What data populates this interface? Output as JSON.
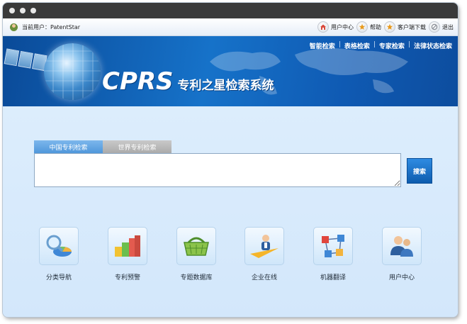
{
  "topbar": {
    "current_user_label": "当前用户：PatentStar",
    "links": [
      {
        "label": "用户中心",
        "icon": "home-icon"
      },
      {
        "label": "帮助",
        "icon": "star-icon"
      },
      {
        "label": "客户端下载",
        "icon": "star-icon"
      },
      {
        "label": "退出",
        "icon": "no-entry-icon"
      }
    ]
  },
  "banner": {
    "logo_text": "CPRS",
    "title": "专利之星检索系统",
    "search_nav": [
      "智能检索",
      "表格检索",
      "专家检索",
      "法律状态检索"
    ]
  },
  "search": {
    "tabs": [
      "中国专利检索",
      "世界专利检索"
    ],
    "active_tab": "中国专利检索",
    "query_value": "",
    "button_label": "搜索"
  },
  "features": [
    {
      "label": "分类导航",
      "icon": "magnifier-pie-icon"
    },
    {
      "label": "专利预警",
      "icon": "bar-blocks-icon"
    },
    {
      "label": "专题数据库",
      "icon": "basket-icon"
    },
    {
      "label": "企业在线",
      "icon": "paper-plane-person-icon"
    },
    {
      "label": "机器翻译",
      "icon": "network-nodes-icon"
    },
    {
      "label": "用户中心",
      "icon": "users-icon"
    }
  ],
  "colors": {
    "banner_blue": "#1672c9",
    "tab_active": "#4d95da",
    "button_blue": "#0d5cae",
    "page_bg": "#dcebfb"
  }
}
